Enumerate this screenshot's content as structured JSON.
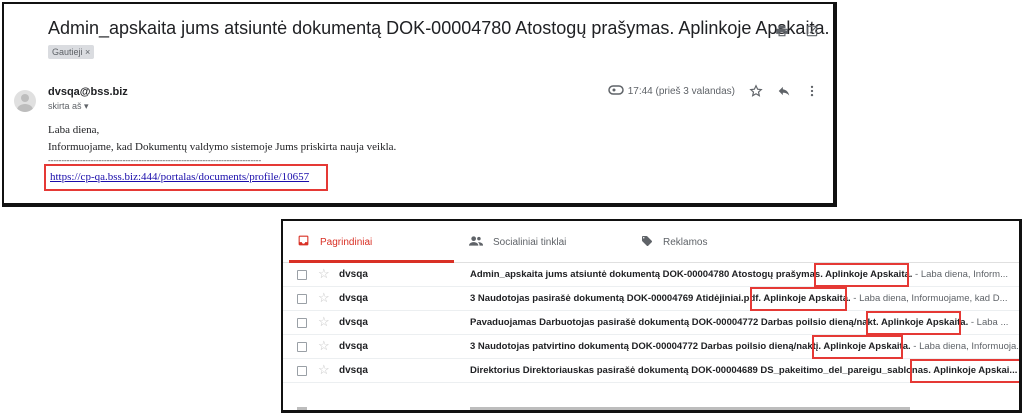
{
  "email": {
    "subject": "Admin_apskaita jums atsiuntė dokumentą DOK-00004780 Atostogų prašymas. Aplinkoje Apskaita.",
    "label": "Gautieji ×",
    "sender": "dvsqa@bss.biz",
    "to": "skirta aš ▾",
    "time": "17:44 (prieš 3 valandas)",
    "greeting": "Laba diena,",
    "body": "Informuojame, kad Dokumentų valdymo sistemoje Jums priskirta nauja veikla.",
    "dashes": "--------------------------------------------------------------------------------",
    "link": "https://cp-qa.bss.biz:444/portalas/documents/profile/10657"
  },
  "inbox": {
    "tabs": [
      {
        "label": "Pagrindiniai",
        "icon": "inbox-icon",
        "color": "#d93025"
      },
      {
        "label": "Socialiniai tinklai",
        "icon": "people-icon"
      },
      {
        "label": "Reklamos",
        "icon": "tag-icon"
      }
    ],
    "rows": [
      {
        "from": "dvsqa",
        "subject": "Admin_apskaita jums atsiuntė dokumentą DOK-00004780 Atostogų prašymas.",
        "highlight": " Aplinkoje Apskaita.",
        "snippet": " - Laba diena, Inform..."
      },
      {
        "from": "dvsqa",
        "subject": "3 Naudotojas pasirašė dokumentą DOK-00004769 Atidėjiniai.pdf.",
        "highlight": " Aplinkoje Apskaita.",
        "snippet": " - Laba diena, Informuojame, kad D..."
      },
      {
        "from": "dvsqa",
        "subject": "Pavaduojamas Darbuotojas pasirašė dokumentą DOK-00004772 Darbas poilsio dieną/nakt.",
        "highlight": " Aplinkoje Apskaita.",
        "snippet": " - Laba ..."
      },
      {
        "from": "dvsqa",
        "subject": "3 Naudotojas patvirtino dokumentą DOK-00004772 Darbas poilsio dieną/naktį.",
        "highlight": " Aplinkoje Apskaita.",
        "snippet": " - Laba diena, Informuoja..."
      },
      {
        "from": "dvsqa",
        "subject": "Direktorius Direktoriauskas pasirašė dokumentą DOK-00004689 DS_pakeitimo_del_pareigu_sablonas.",
        "highlight": " Aplinkoje Apskai...",
        "snippet": ""
      }
    ]
  },
  "colors": {
    "accent": "#d93025",
    "highlight_border": "#e53935",
    "link": "#1a0dab"
  }
}
